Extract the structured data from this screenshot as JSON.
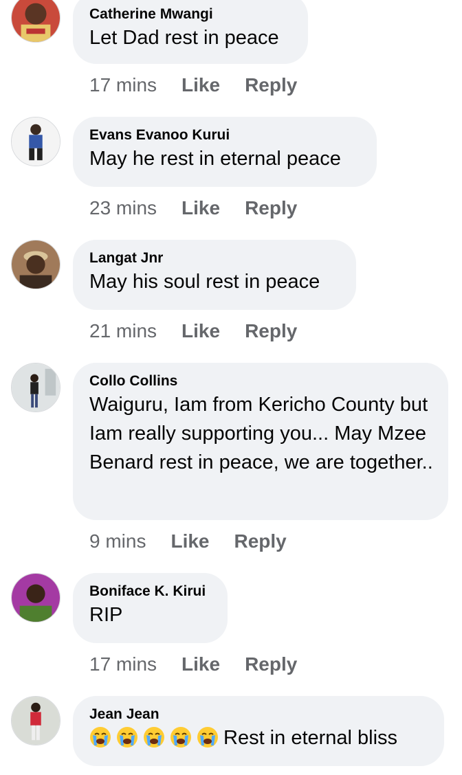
{
  "actions": {
    "like": "Like",
    "reply": "Reply"
  },
  "comments": [
    {
      "author": "Catherine Mwangi",
      "text": "Let Dad rest in peace",
      "time": "17 mins",
      "avatar": "person-avatar"
    },
    {
      "author": "Evans Evanoo Kurui",
      "text": "May he rest in eternal peace",
      "time": "23 mins",
      "avatar": "person-avatar"
    },
    {
      "author": "Langat Jnr",
      "text": "May his soul rest in peace",
      "time": "21 mins",
      "avatar": "person-avatar"
    },
    {
      "author": "Collo Collins",
      "text": "Waiguru, Iam from Kericho County but Iam really supporting you... May Mzee Benard rest in peace, we are together..",
      "time": "9 mins",
      "avatar": "person-avatar"
    },
    {
      "author": "Boniface K. Kirui",
      "text": "RIP",
      "time": "17 mins",
      "avatar": "person-avatar"
    },
    {
      "author": "Jean Jean",
      "text": "Rest in eternal bliss",
      "emoji": "loudly-crying-face",
      "emoji_count": 5,
      "avatar": "person-avatar"
    }
  ],
  "colors": {
    "bubble": "#f0f2f5",
    "meta": "#65676b",
    "text": "#050505"
  }
}
